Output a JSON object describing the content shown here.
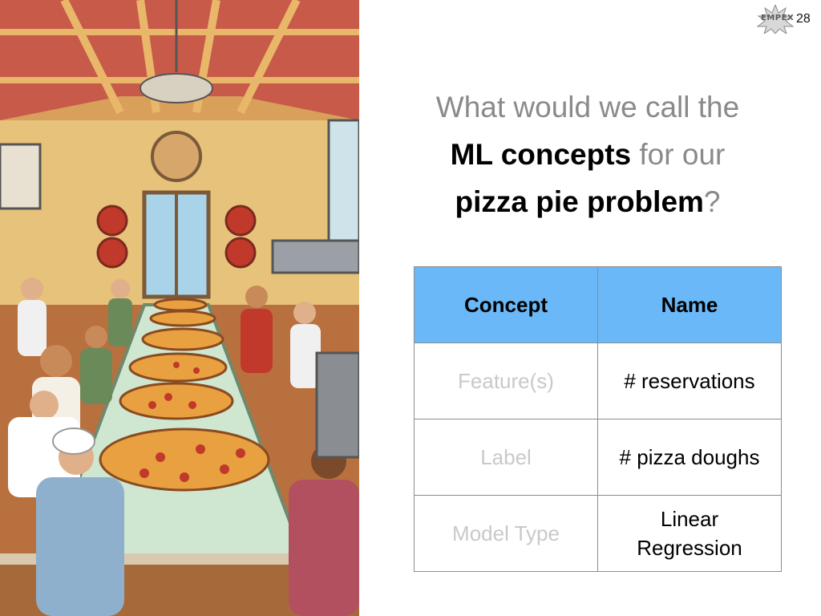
{
  "slide": {
    "page_number": "28",
    "logo": {
      "text": "EMPEX",
      "icon": "starburst-logo-icon"
    },
    "heading": {
      "line1": "What would we call the",
      "line2_strong": "ML concepts",
      "line2_rest": " for our",
      "line3_strong": "pizza pie problem",
      "line3_rest": "?"
    },
    "table": {
      "headers": [
        "Concept",
        "Name"
      ],
      "rows": [
        {
          "concept": "Feature(s)",
          "name": "# reservations"
        },
        {
          "concept": "Label",
          "name": "# pizza doughs"
        },
        {
          "concept": "Model Type",
          "name_line1": "Linear",
          "name_line2": "Regression"
        }
      ]
    },
    "illustration": {
      "subject": "pizza-restaurant-illustration"
    },
    "colors": {
      "header_bg": "#6ab8f7",
      "muted_text": "#8a8a8a",
      "faded_text": "#c9c9c9"
    }
  }
}
